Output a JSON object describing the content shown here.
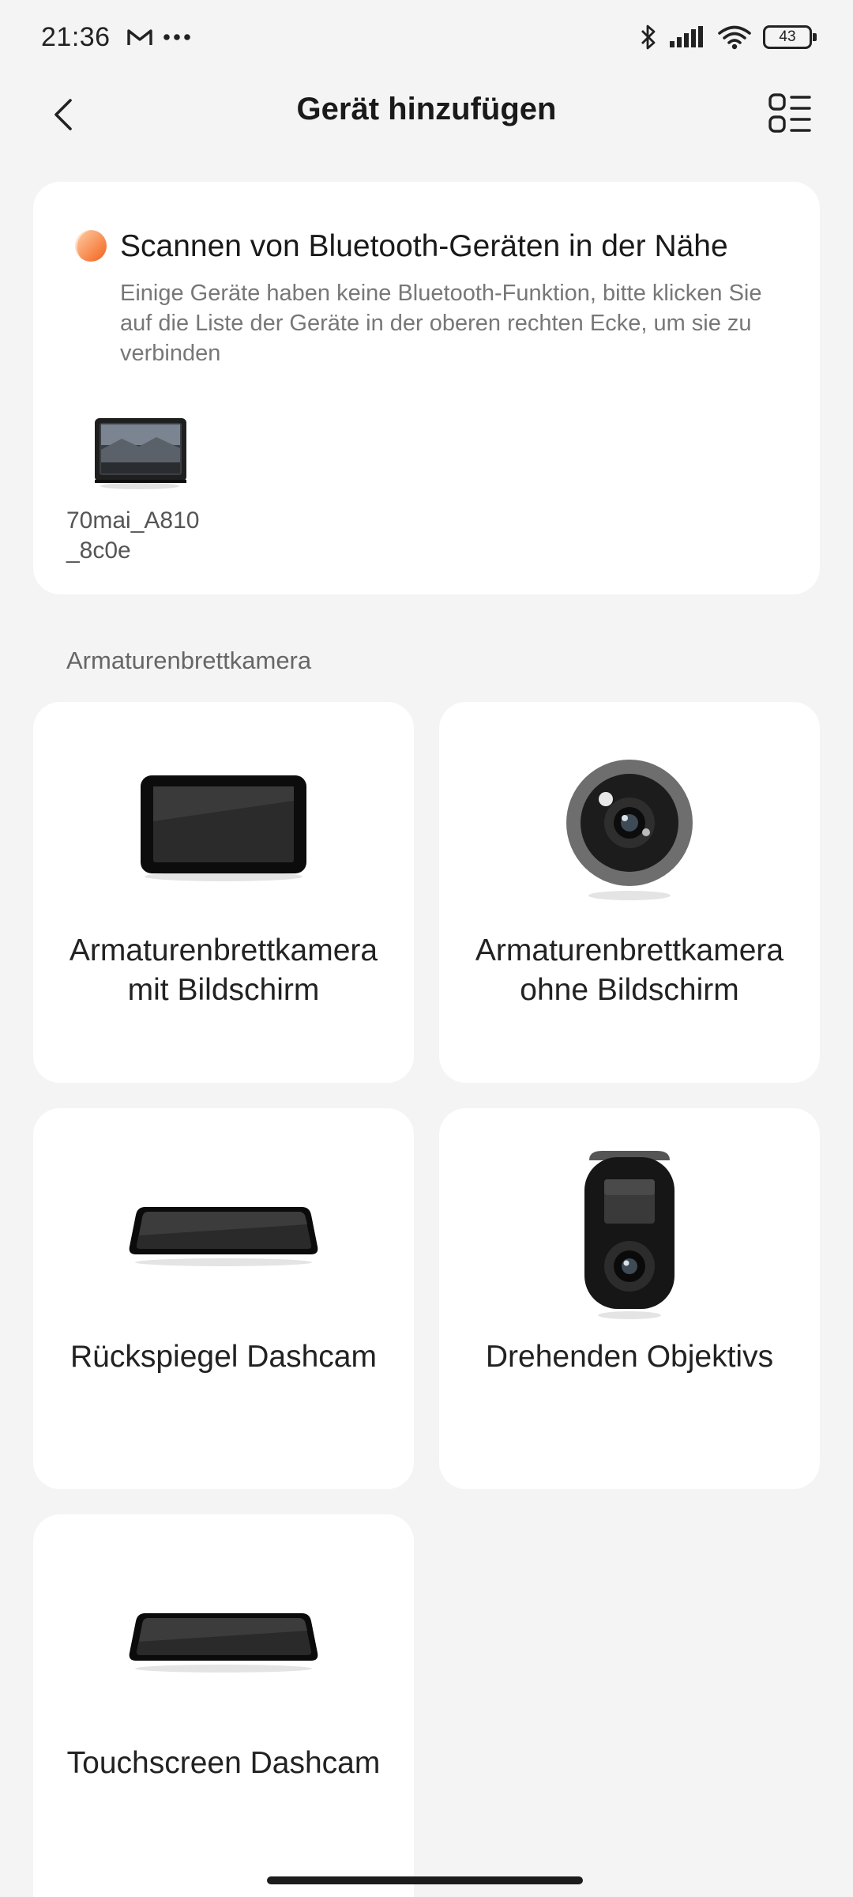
{
  "status_bar": {
    "time": "21:36",
    "battery": "43",
    "left_icons": [
      "gmail-icon",
      "more-dots-icon"
    ],
    "right_icons": [
      "bluetooth-icon",
      "signal-icon",
      "wifi-icon",
      "battery-icon"
    ]
  },
  "header": {
    "title": "Gerät hinzufügen",
    "back_icon": "chevron-left-icon",
    "list_icon": "device-list-icon"
  },
  "bluetooth_scan": {
    "title": "Scannen von Bluetooth-Geräten in der Nähe",
    "description": "Einige Geräte haben keine Bluetooth-Funktion, bitte klicken Sie auf die Liste der Geräte in der oberen rechten Ecke, um sie zu verbinden",
    "devices": [
      {
        "name": "70mai_A810\n_8c0e"
      }
    ]
  },
  "section": {
    "label": "Armaturenbrettkamera"
  },
  "tiles": [
    {
      "label": "Armaturenbrettkamera mit Bildschirm",
      "icon": "dashcam-screen-icon"
    },
    {
      "label": "Armaturenbrettkamera ohne Bildschirm",
      "icon": "dashcam-lens-icon"
    },
    {
      "label": "Rückspiegel Dashcam",
      "icon": "rearview-mirror-dashcam-icon"
    },
    {
      "label": "Drehenden Objektivs",
      "icon": "rotating-lens-dashcam-icon"
    },
    {
      "label": "Touchscreen Dashcam",
      "icon": "touchscreen-dashcam-icon"
    }
  ],
  "colors": {
    "background": "#f4f4f4",
    "card": "#ffffff",
    "accent": "#f26b1d"
  }
}
